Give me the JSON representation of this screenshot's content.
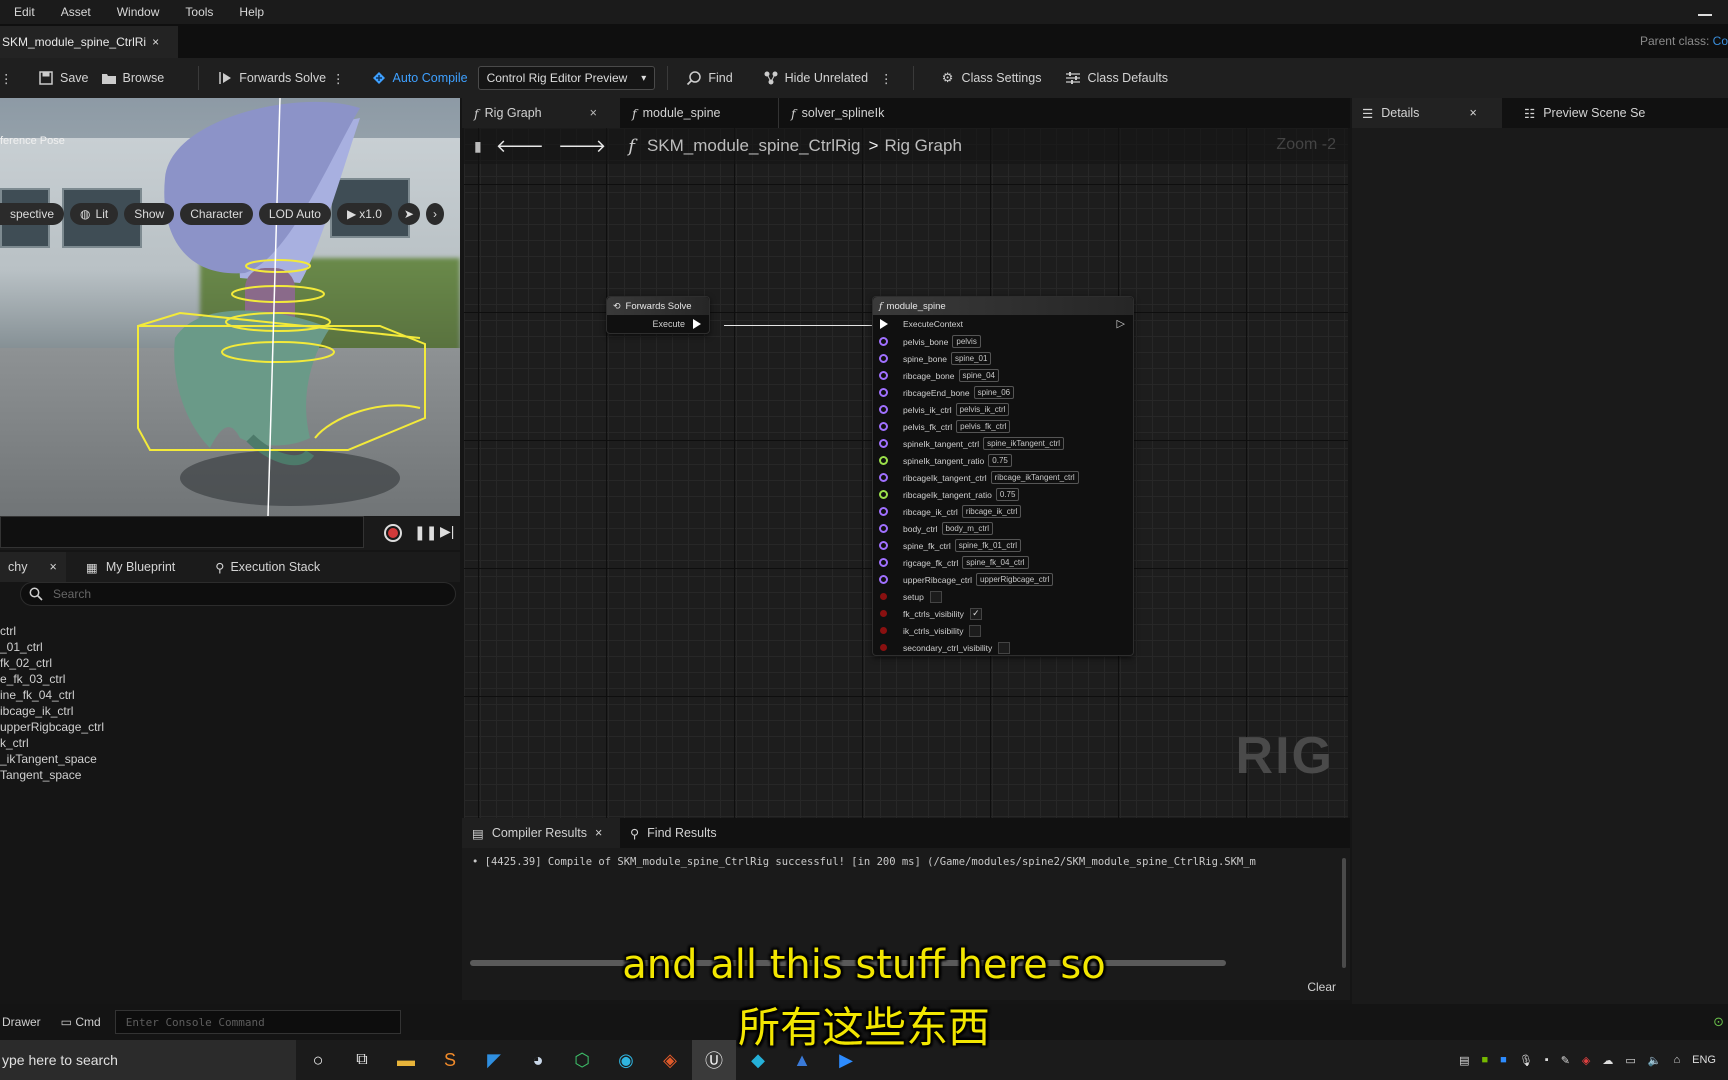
{
  "menu": [
    "Edit",
    "Asset",
    "Window",
    "Tools",
    "Help"
  ],
  "doc_tab": {
    "label": "SKM_module_spine_CtrlRi",
    "close": "×"
  },
  "parent_class": {
    "label": "Parent class:",
    "value": "Co"
  },
  "toolbar": {
    "save": "Save",
    "browse": "Browse",
    "forwards_solve": "Forwards Solve",
    "auto_compile": "Auto Compile",
    "preview_dropdown": "Control Rig Editor Preview",
    "find": "Find",
    "hide_unrelated": "Hide Unrelated",
    "class_settings": "Class Settings",
    "class_defaults": "Class Defaults"
  },
  "viewport": {
    "buttons": [
      "spective",
      "Lit",
      "Show",
      "Character",
      "LOD Auto",
      "x1.0"
    ],
    "label": "ference Pose"
  },
  "left_tabs": {
    "hierarchy": "chy",
    "my_blueprint": "My Blueprint",
    "execution_stack": "Execution Stack"
  },
  "search": {
    "placeholder": "Search"
  },
  "tree": [
    "ctrl",
    "_01_ctrl",
    "fk_02_ctrl",
    "e_fk_03_ctrl",
    "ine_fk_04_ctrl",
    "ibcage_ik_ctrl",
    "upperRigbcage_ctrl",
    "k_ctrl",
    "_ikTangent_space",
    "Tangent_space"
  ],
  "graph_tabs": [
    {
      "label": "Rig Graph",
      "close": "×"
    },
    {
      "label": "module_spine"
    },
    {
      "label": "solver_splineIk"
    }
  ],
  "breadcrumb": {
    "root": "SKM_module_spine_CtrlRig",
    "sep": ">",
    "leaf": "Rig Graph"
  },
  "zoom": "Zoom -2",
  "watermark": "RIG",
  "forwards_node": {
    "title": "Forwards Solve",
    "pin": "Execute"
  },
  "module_node": {
    "title": "module_spine",
    "exec": "ExecuteContext",
    "pins": [
      {
        "name": "pelvis_bone",
        "value": "pelvis",
        "kind": "purple"
      },
      {
        "name": "spine_bone",
        "value": "spine_01",
        "kind": "purple"
      },
      {
        "name": "ribcage_bone",
        "value": "spine_04",
        "kind": "purple"
      },
      {
        "name": "ribcageEnd_bone",
        "value": "spine_06",
        "kind": "purple"
      },
      {
        "name": "pelvis_ik_ctrl",
        "value": "pelvis_ik_ctrl",
        "kind": "purple"
      },
      {
        "name": "pelvis_fk_ctrl",
        "value": "pelvis_fk_ctrl",
        "kind": "purple"
      },
      {
        "name": "spineIk_tangent_ctrl",
        "value": "spine_ikTangent_ctrl",
        "kind": "purple"
      },
      {
        "name": "spineIk_tangent_ratio",
        "value": "0.75",
        "kind": "green"
      },
      {
        "name": "ribcageIk_tangent_ctrl",
        "value": "ribcage_ikTangent_ctrl",
        "kind": "purple"
      },
      {
        "name": "ribcageIk_tangent_ratio",
        "value": "0.75",
        "kind": "green"
      },
      {
        "name": "ribcage_ik_ctrl",
        "value": "ribcage_ik_ctrl",
        "kind": "purple"
      },
      {
        "name": "body_ctrl",
        "value": "body_m_ctrl",
        "kind": "purple"
      },
      {
        "name": "spine_fk_ctrl",
        "value": "spine_fk_01_ctrl",
        "kind": "purple"
      },
      {
        "name": "rigcage_fk_ctrl",
        "value": "spine_fk_04_ctrl",
        "kind": "purple"
      },
      {
        "name": "upperRibcage_ctrl",
        "value": "upperRigbcage_ctrl",
        "kind": "purple"
      }
    ],
    "bools": [
      {
        "name": "setup",
        "checked": ""
      },
      {
        "name": "fk_ctrls_visibility",
        "checked": "✓"
      },
      {
        "name": "ik_ctrls_visibility",
        "checked": ""
      },
      {
        "name": "secondary_ctrl_visibility",
        "checked": ""
      }
    ]
  },
  "bottom_tabs": {
    "compiler": "Compiler Results",
    "compiler_close": "×",
    "find": "Find Results"
  },
  "log_line": "•  [4425.39] Compile of SKM_module_spine_CtrlRig successful! [in 200 ms] (/Game/modules/spine2/SKM_module_spine_CtrlRig.SKM_m",
  "clear": "Clear",
  "right_tabs": {
    "details": "Details",
    "details_close": "×",
    "preview": "Preview Scene Se"
  },
  "status": {
    "drawer": "Drawer",
    "cmd": "Cmd",
    "console_placeholder": "Enter Console Command"
  },
  "taskbar": {
    "search": "ype here to search",
    "lang": "ENG"
  },
  "subtitles": {
    "en": "and all this stuff here so",
    "zh": "所有这些东西"
  }
}
